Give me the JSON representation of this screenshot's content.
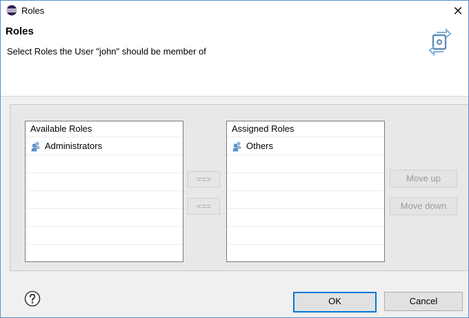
{
  "window": {
    "title": "Roles",
    "close_glyph": "✕"
  },
  "header": {
    "title": "Roles",
    "description": "Select Roles the User \"john\" should be member of",
    "icon": "sync-roles-icon"
  },
  "available": {
    "header": "Available Roles",
    "items": [
      {
        "label": "Administrators",
        "icon": "role-group-icon"
      }
    ]
  },
  "assigned": {
    "header": "Assigned Roles",
    "items": [
      {
        "label": "Others",
        "icon": "role-group-icon"
      }
    ]
  },
  "transfer": {
    "add_label": "==>",
    "remove_label": "<=="
  },
  "order": {
    "move_up_label": "Move up",
    "move_down_label": "Move down"
  },
  "footer": {
    "ok_label": "OK",
    "cancel_label": "Cancel",
    "help_icon": "help-icon"
  },
  "colors": {
    "accent": "#0078d7",
    "disabled_text": "#a0a0a0"
  }
}
